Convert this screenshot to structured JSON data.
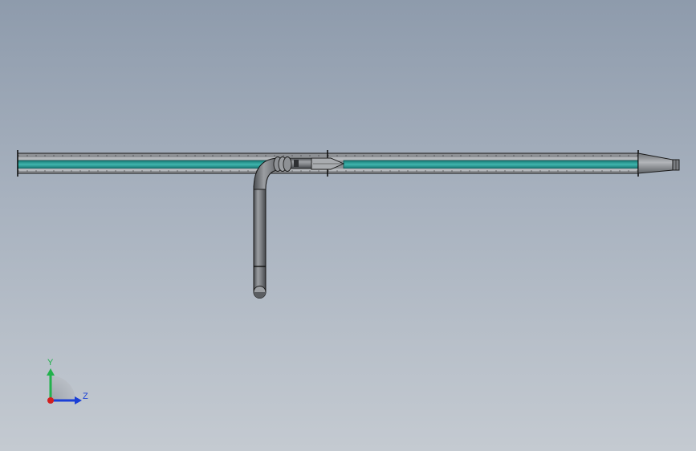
{
  "scene": {
    "model": "pipe-assembly",
    "colors": {
      "background_top": "#8e9bac",
      "background_bottom": "#c4cad1",
      "pipe_gray": "#8a8d91",
      "pipe_dark": "#3b3d40",
      "teal_core": "#1f8f8a",
      "teal_light": "#3fb5ad",
      "edge": "#1a1a1a"
    }
  },
  "triad": {
    "y_label": "Y",
    "z_label": "Z",
    "y_color": "#22b14c",
    "z_color": "#1a3fd6",
    "x_color": "#d21f1f"
  }
}
